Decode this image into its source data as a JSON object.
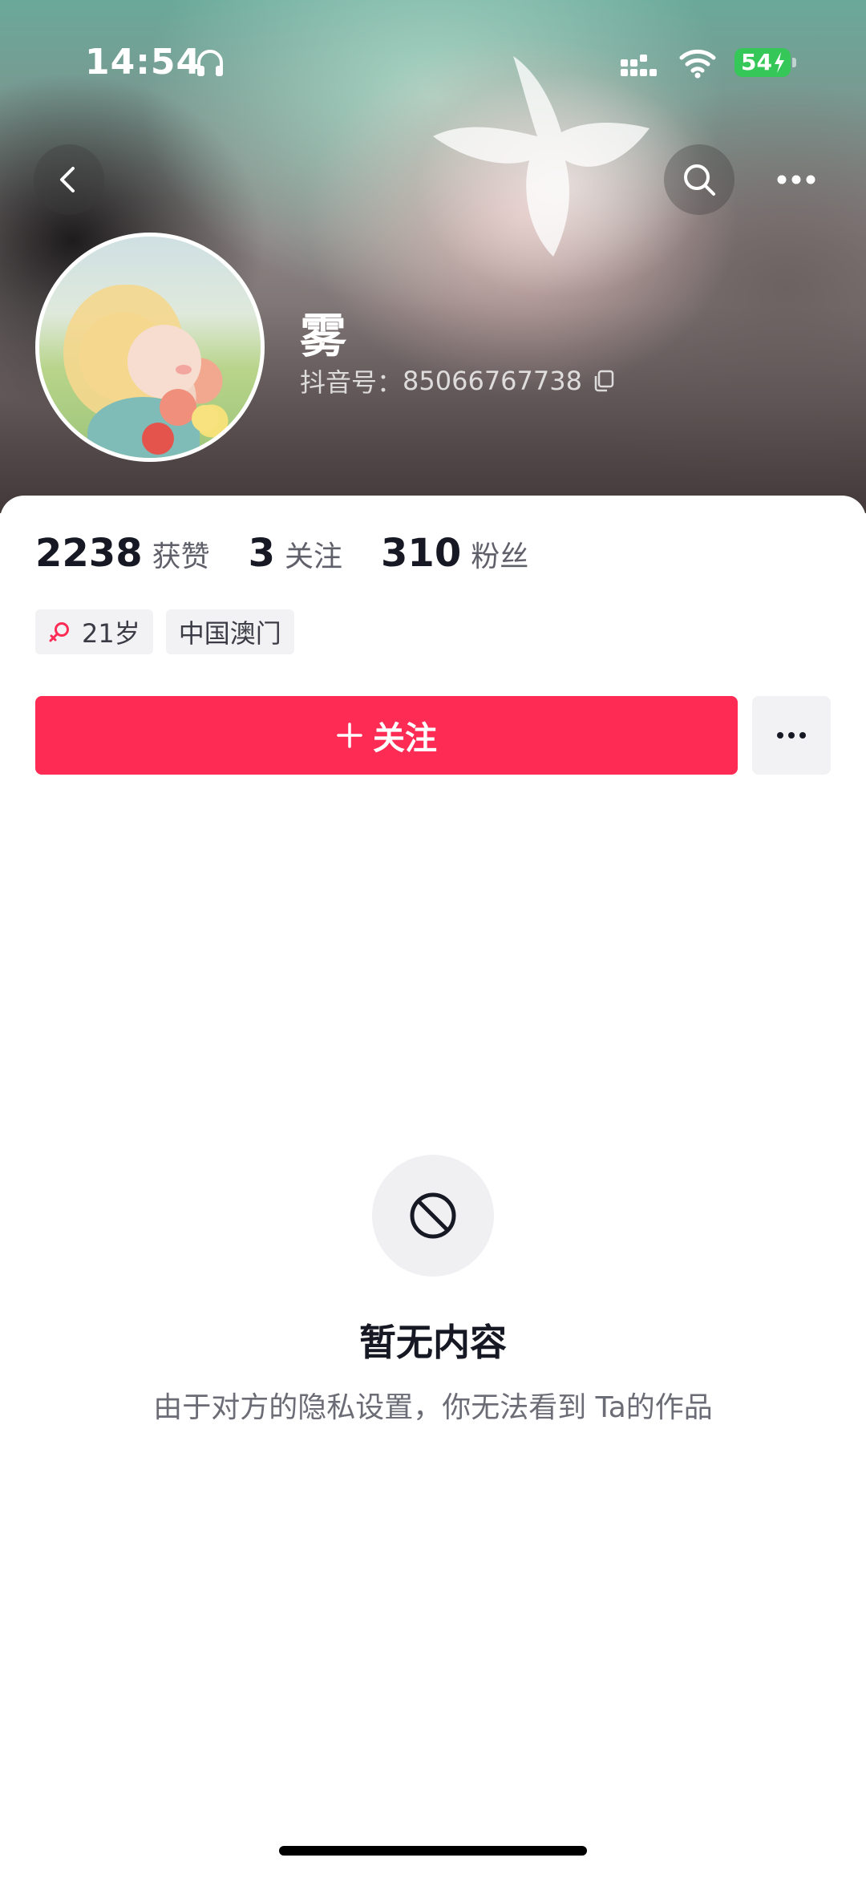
{
  "status_bar": {
    "time": "14:54",
    "battery": "54"
  },
  "profile": {
    "nickname": "雾",
    "douyin_id_label": "抖音号：",
    "douyin_id": "85066767738"
  },
  "stats": [
    {
      "value": "2238",
      "label": "获赞"
    },
    {
      "value": "3",
      "label": "关注"
    },
    {
      "value": "310",
      "label": "粉丝"
    }
  ],
  "tags": {
    "age": "21岁",
    "location": "中国澳门"
  },
  "actions": {
    "follow_label": "关注"
  },
  "empty_state": {
    "title": "暂无内容",
    "subtitle": "由于对方的隐私设置，你无法看到 Ta的作品"
  },
  "colors": {
    "accent": "#fe2c55",
    "battery": "#36c759",
    "gender": "#fe2c55"
  },
  "icons": [
    "headphones-icon",
    "signal-icon",
    "wifi-icon",
    "battery-icon",
    "back-icon",
    "search-icon",
    "more-icon",
    "copy-icon",
    "female-icon",
    "plus-icon",
    "more-options-icon",
    "blocked-icon"
  ]
}
